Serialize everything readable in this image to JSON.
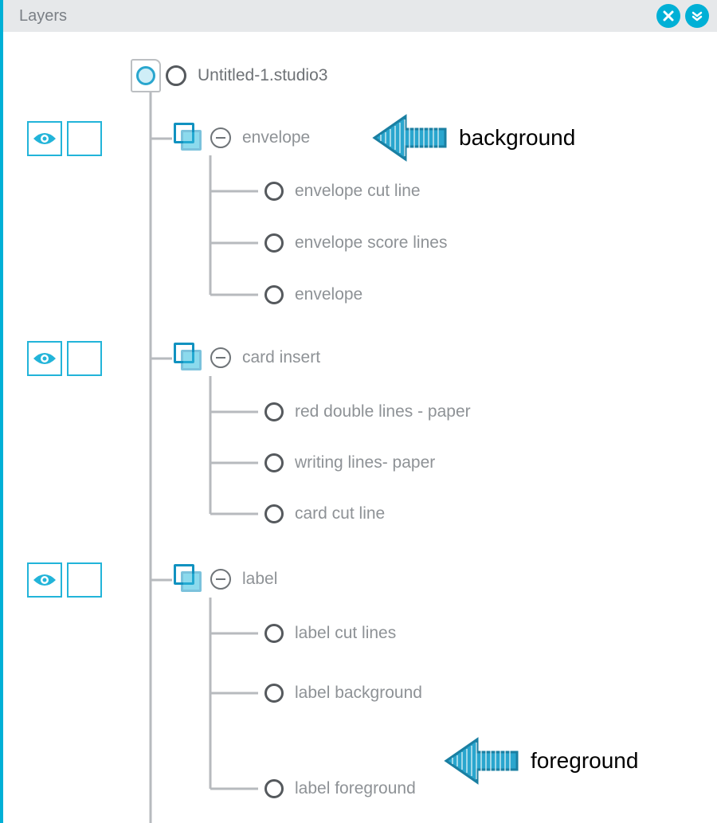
{
  "panel": {
    "title": "Layers"
  },
  "root": {
    "filename": "Untitled-1.studio3"
  },
  "groups": [
    {
      "name": "envelope",
      "children": [
        "envelope cut line",
        "envelope score lines",
        "envelope"
      ]
    },
    {
      "name": "card insert",
      "children": [
        "red double lines - paper",
        "writing lines- paper",
        "card cut line"
      ]
    },
    {
      "name": "label",
      "children": [
        "label cut lines",
        "label background",
        "label foreground"
      ]
    }
  ],
  "annotations": {
    "background": "background",
    "foreground": "foreground"
  }
}
